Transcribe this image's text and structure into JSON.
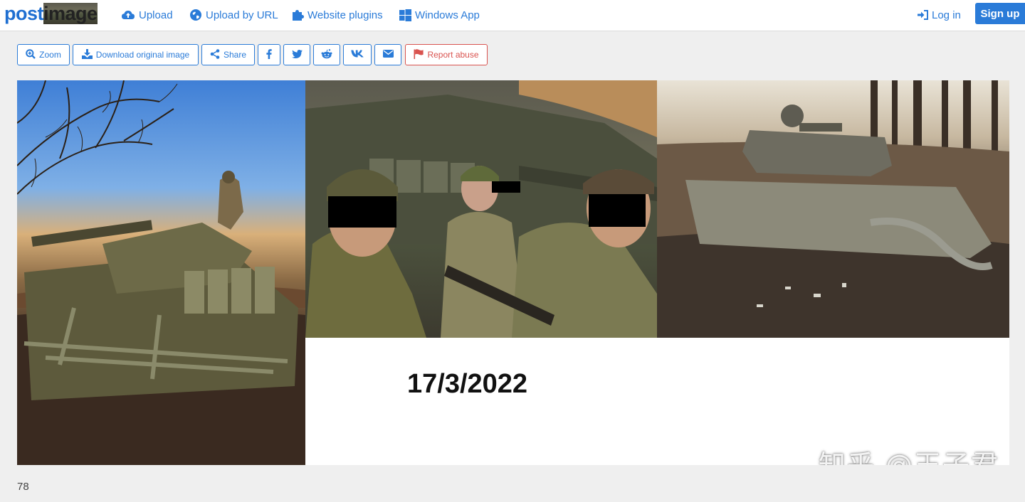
{
  "brand": {
    "logo_part1": "post",
    "logo_part2": "image"
  },
  "nav": {
    "upload": "Upload",
    "upload_by_url": "Upload by URL",
    "website_plugins": "Website plugins",
    "windows_app": "Windows App",
    "login": "Log in",
    "signup": "Sign up"
  },
  "toolbar": {
    "zoom": "Zoom",
    "download": "Download original image",
    "share": "Share",
    "report": "Report abuse",
    "social_icons": [
      "facebook-icon",
      "twitter-icon",
      "reddit-icon",
      "vk-icon",
      "email-icon"
    ]
  },
  "image": {
    "date_text": "17/3/2022",
    "watermark": "知乎 @王子君"
  },
  "footer": {
    "number": "78"
  },
  "colors": {
    "accent": "#2a7bd8",
    "danger": "#d9534f",
    "background": "#efefef"
  }
}
